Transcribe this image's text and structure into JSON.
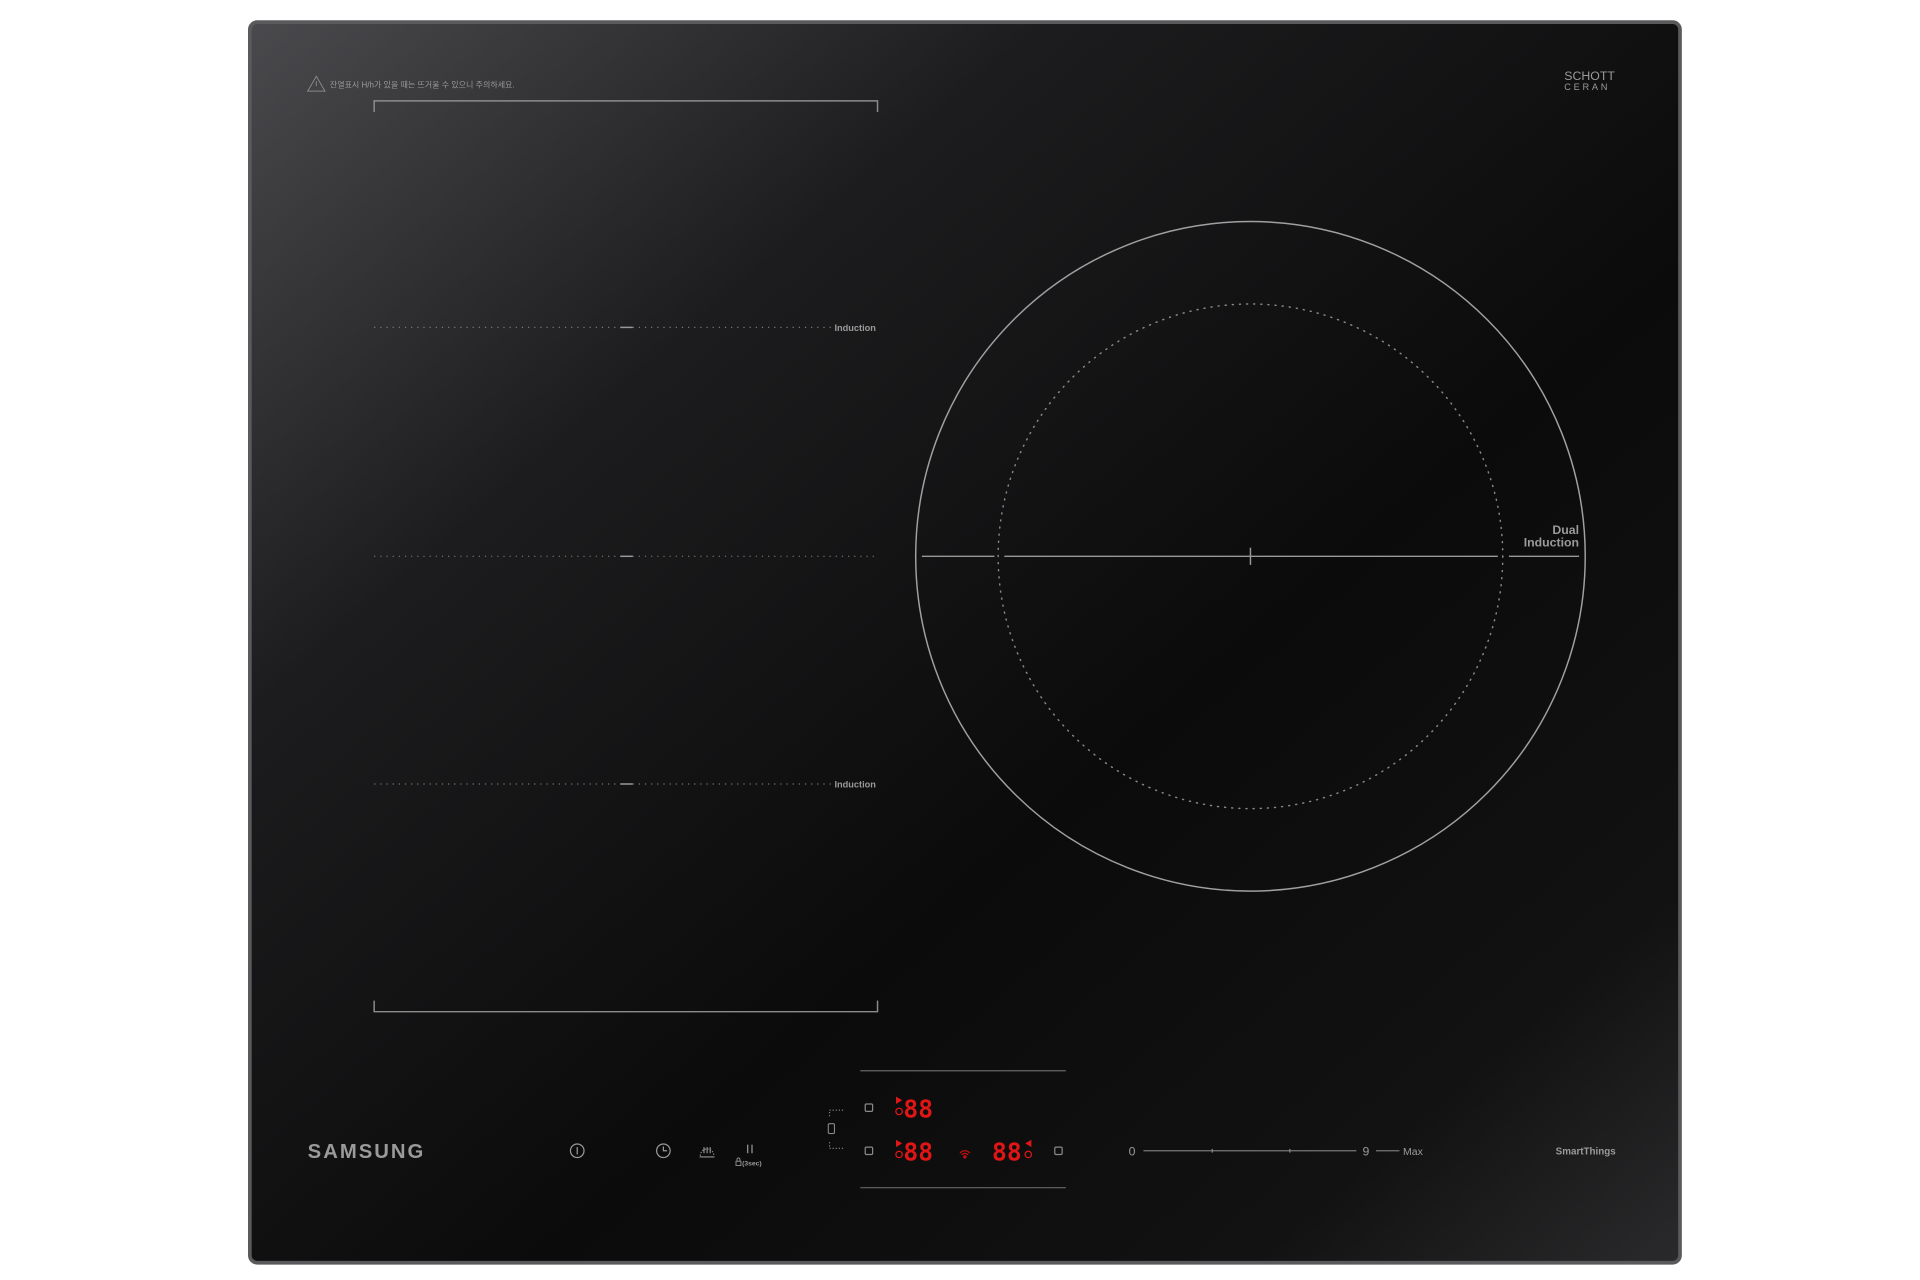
{
  "brand": {
    "logo": "SAMSUNG",
    "glass_logo_line1": "SCHOTT",
    "glass_logo_line2": "CERAN"
  },
  "warning": {
    "icon": "warning-triangle-icon",
    "text": "잔열표시 H/h가 있을 때는 뜨거울 수 있으니 주의하세요."
  },
  "zones": {
    "left_top_label": "Induction",
    "left_bottom_label": "Induction",
    "right_label_line1": "Dual",
    "right_label_line2": "Induction"
  },
  "controls": {
    "power_icon": "power-icon",
    "timer_icon": "timer-clock-icon",
    "keep_warm_icon": "keep-warm-icon",
    "pause_icon": "pause-icon",
    "lock_hint": "(3sec)",
    "displays": {
      "top_left": "88",
      "bottom_left": "88",
      "bottom_right": "88"
    },
    "wifi_icon": "wifi-icon",
    "slider": {
      "min_label": "0",
      "max_label": "9",
      "boost_label": "Max"
    },
    "smartthings": "SmartThings"
  },
  "colors": {
    "display": "#e01515",
    "glass": "#0d0d0d",
    "print": "#9a9a9a"
  }
}
